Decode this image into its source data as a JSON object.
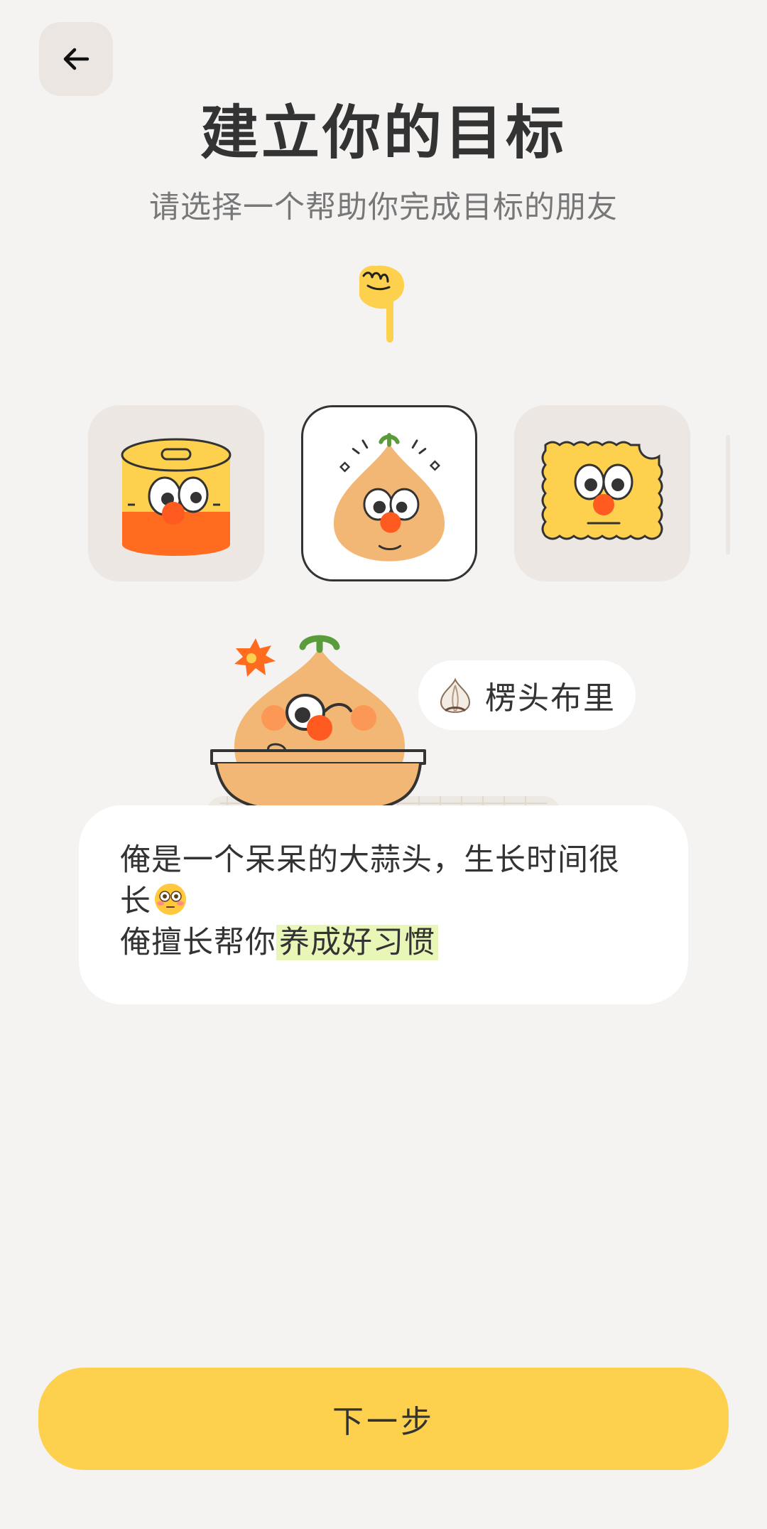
{
  "header": {
    "back_icon": "arrow-left-icon",
    "title": "建立你的目标",
    "subtitle": "请选择一个帮助你完成目标的朋友"
  },
  "pointer_icon": "pointing-hand-icon",
  "characters": [
    {
      "icon": "canned-food-character-icon",
      "selected": false
    },
    {
      "icon": "garlic-character-icon",
      "selected": true
    },
    {
      "icon": "biscuit-character-icon",
      "selected": false
    }
  ],
  "featured": {
    "name_icon": "garlic-icon",
    "name": "楞头布里",
    "description": {
      "line1": "俺是一个呆呆的大蒜头，生长时间很",
      "line2": "长",
      "line2_emoji": "flushed-face-icon",
      "line3_prefix": "俺擅长帮你",
      "line3_highlight": "养成好习惯"
    }
  },
  "footer": {
    "next_label": "下一步"
  },
  "colors": {
    "background": "#f4f3f2",
    "accent_button": "#fdd14e",
    "card_bg": "#ece7e2",
    "garlic_body": "#f2b774",
    "nose": "#ff5a1f",
    "highlight": "#e8f6b8"
  }
}
